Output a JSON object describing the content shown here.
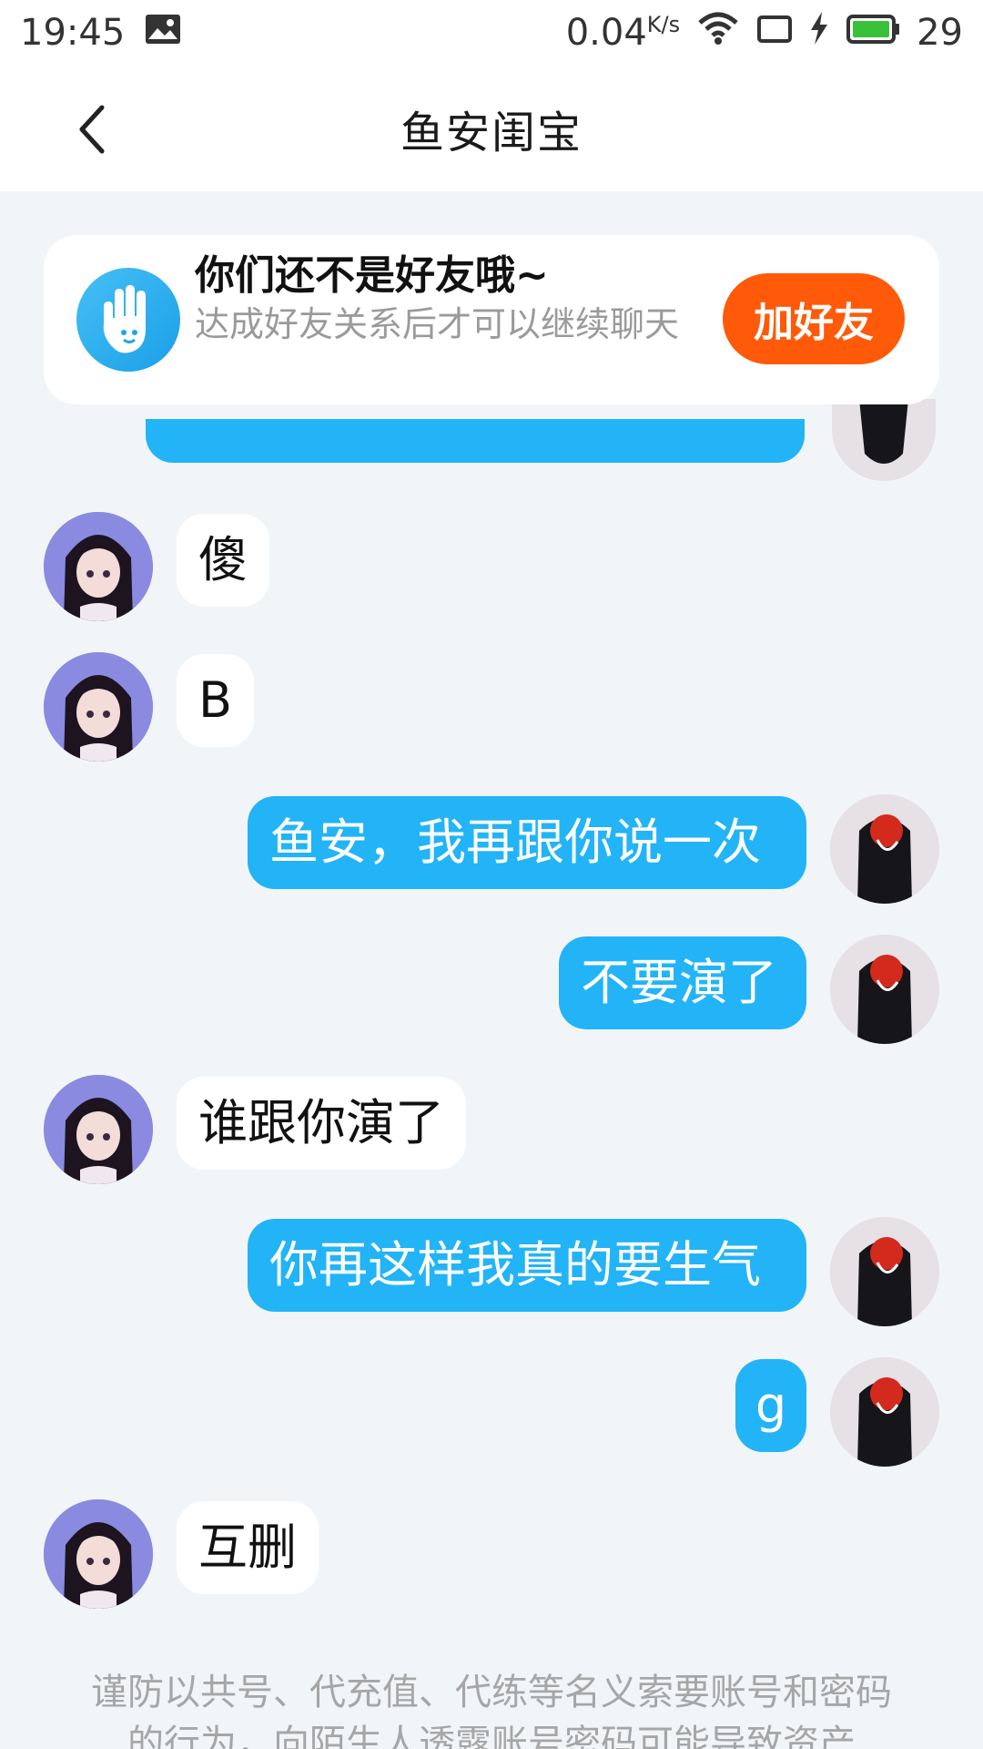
{
  "status_bar": {
    "time": "19:45",
    "speed": "0.04",
    "speed_unit": "K/s",
    "battery": "29"
  },
  "nav": {
    "title": "鱼安闺宝"
  },
  "banner": {
    "title": "你们还不是好友哦~",
    "subtitle": "达成好友关系后才可以继续聊天",
    "button": "加好友"
  },
  "messages": [
    {
      "side": "in",
      "text": "傻"
    },
    {
      "side": "in",
      "text": "B"
    },
    {
      "side": "out",
      "text": "鱼安，我再跟你说一次"
    },
    {
      "side": "out",
      "text": "不要演了"
    },
    {
      "side": "in",
      "text": "谁跟你演了"
    },
    {
      "side": "out",
      "text": "你再这样我真的要生气"
    },
    {
      "side": "out",
      "text": "g"
    },
    {
      "side": "in",
      "text": "互删"
    }
  ],
  "disclaimer": "谨防以共号、代充值、代练等名义索要账号和密码的行为，向陌生人透露账号密码可能导致资产"
}
